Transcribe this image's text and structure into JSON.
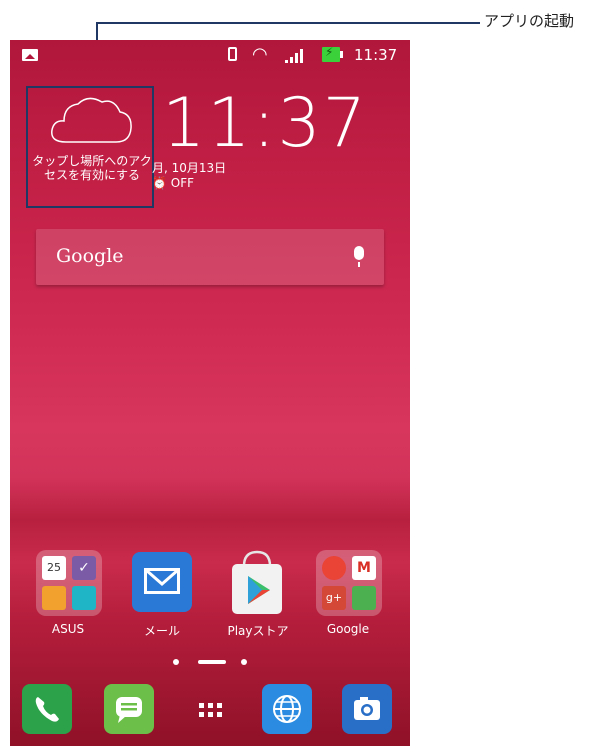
{
  "callout": {
    "label": "アプリの起動"
  },
  "status_bar": {
    "time": "11:37"
  },
  "clock": {
    "time": "11:37",
    "date": "月, 10月13日",
    "alarm": "OFF"
  },
  "weather": {
    "text": "タップし場所へのアクセスを有効にする"
  },
  "search": {
    "label": "Google"
  },
  "apps": [
    {
      "label": "ASUS"
    },
    {
      "label": "メール"
    },
    {
      "label": "Playストア"
    },
    {
      "label": "Google"
    }
  ],
  "dock": [
    "phone-icon",
    "messages-icon",
    "all-apps-icon",
    "browser-icon",
    "camera-icon"
  ],
  "colors": {
    "accent": "#c21f45",
    "callout": "#1f3864"
  }
}
